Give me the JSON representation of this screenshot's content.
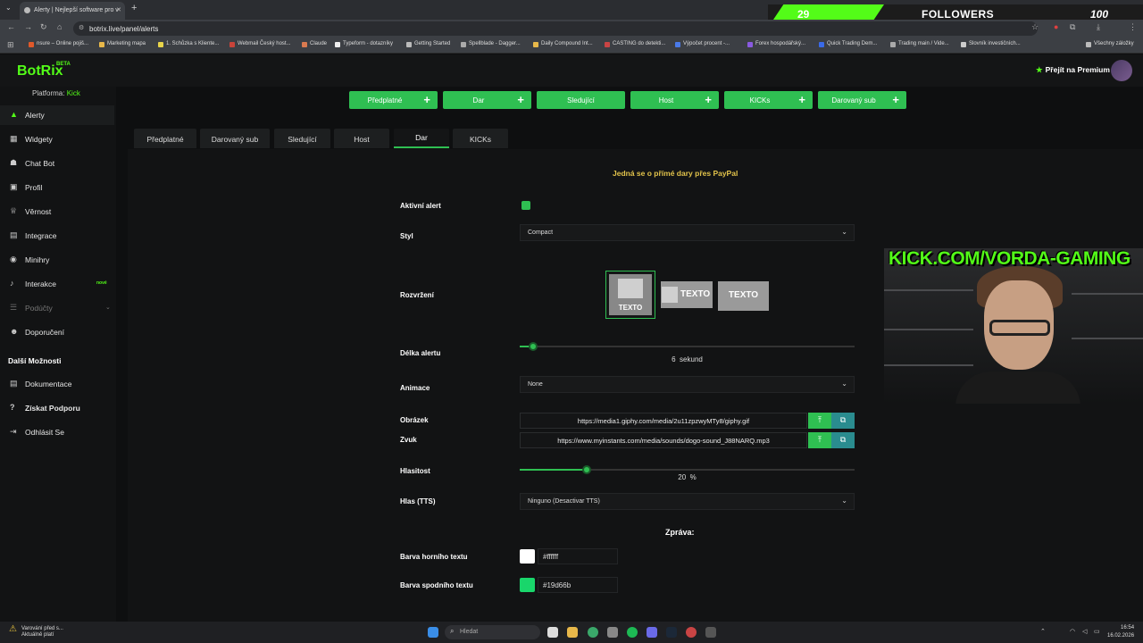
{
  "browser": {
    "tab_title": "Alerty | Nejlepší software pro v",
    "url": "botrix.live/panel/alerts",
    "bookmarks": [
      {
        "label": "nsure – Online pojiš...",
        "color": "#e0592a"
      },
      {
        "label": "Marketing mapa",
        "color": "#e8b84a"
      },
      {
        "label": "1. Schůzka s Kliente...",
        "color": "#e8d44a"
      },
      {
        "label": "Webmail Český host...",
        "color": "#c9443a"
      },
      {
        "label": "Claude",
        "color": "#d97a50"
      },
      {
        "label": "Typeform - dotazníky",
        "color": "#eeeeee"
      },
      {
        "label": "Getting Started",
        "color": "#bbbbbb"
      },
      {
        "label": "Spellblade - Dagger...",
        "color": "#aaaaaa"
      },
      {
        "label": "Daily Compound Int...",
        "color": "#e8b84a"
      },
      {
        "label": "CASTING do detekti...",
        "color": "#c94444"
      },
      {
        "label": "Výpočet procent -...",
        "color": "#4a7ae8"
      },
      {
        "label": "Forex hospodářský...",
        "color": "#8a5ae0"
      },
      {
        "label": "Quick Trading Dem...",
        "color": "#3a6ae8"
      },
      {
        "label": "Trading main / Vide...",
        "color": "#aaaaaa"
      },
      {
        "label": "Slovník investičních...",
        "color": "#cccccc"
      },
      {
        "label": "Všechny záložky",
        "color": "#bbbbbb"
      }
    ]
  },
  "overlay": {
    "followers_count": "29",
    "followers_label": "FOLLOWERS",
    "followers_goal": "100",
    "cam_banner": "KICK.COM/VORDA-GAMING"
  },
  "app": {
    "logo": "BotRix",
    "beta": "BETA",
    "premium": "Přejít na Premium",
    "platform_label": "Platforma:",
    "platform_value": "Kick"
  },
  "sidebar": {
    "items": [
      {
        "label": "Alerty",
        "icon": "warning-icon"
      },
      {
        "label": "Widgety",
        "icon": "grid-icon"
      },
      {
        "label": "Chat Bot",
        "icon": "bot-icon"
      },
      {
        "label": "Profil",
        "icon": "profile-icon"
      },
      {
        "label": "Věrnost",
        "icon": "trophy-icon"
      },
      {
        "label": "Integrace",
        "icon": "integration-icon"
      },
      {
        "label": "Minihry",
        "icon": "gamepad-icon"
      },
      {
        "label": "Interakce",
        "icon": "music-icon",
        "badge": "nové"
      },
      {
        "label": "Podúčty",
        "icon": "users-icon"
      },
      {
        "label": "Doporučení",
        "icon": "referral-icon"
      }
    ],
    "section": "Další Možnosti",
    "extra": [
      {
        "label": "Dokumentace",
        "icon": "document-icon"
      },
      {
        "label": "Získat Podporu",
        "icon": "help-icon"
      },
      {
        "label": "Odhlásit Se",
        "icon": "logout-icon"
      }
    ]
  },
  "add_buttons": [
    "Předplatné",
    "Dar",
    "Sledující",
    "Host",
    "KICKs",
    "Darovaný sub"
  ],
  "tabs": [
    "Předplatné",
    "Darovaný sub",
    "Sledující",
    "Host",
    "Dar",
    "KICKs"
  ],
  "active_tab": "Dar",
  "form": {
    "note": "Jedná se o přímé dary přes PayPal",
    "active_label": "Aktivní alert",
    "style_label": "Styl",
    "style_value": "Compact",
    "layout_label": "Rozvržení",
    "layout_text": "TEXTO",
    "duration_label": "Délka alertu",
    "duration_value": "6",
    "duration_unit": "sekund",
    "duration_fraction": 0.04,
    "animation_label": "Animace",
    "animation_value": "None",
    "image_label": "Obrázek",
    "image_url": "https://media1.giphy.com/media/2u11zpzwyMTy8/giphy.gif",
    "sound_label": "Zvuk",
    "sound_url": "https://www.myinstants.com/media/sounds/dogo-sound_J88NARQ.mp3",
    "volume_label": "Hlasitost",
    "volume_value": "20",
    "volume_unit": "%",
    "volume_fraction": 0.2,
    "tts_label": "Hlas (TTS)",
    "tts_value": "Ninguno (Desactivar TTS)",
    "message_heading": "Zpráva:",
    "top_color_label": "Barva horního textu",
    "top_color_value": "#ffffff",
    "bottom_color_label": "Barva spodního textu",
    "bottom_color_value": "#19d66b"
  },
  "taskbar": {
    "warning_title": "Varování před s...",
    "warning_sub": "Aktuálně platí",
    "search_placeholder": "Hledat",
    "time": "16:54",
    "date": "16.02.2026"
  }
}
